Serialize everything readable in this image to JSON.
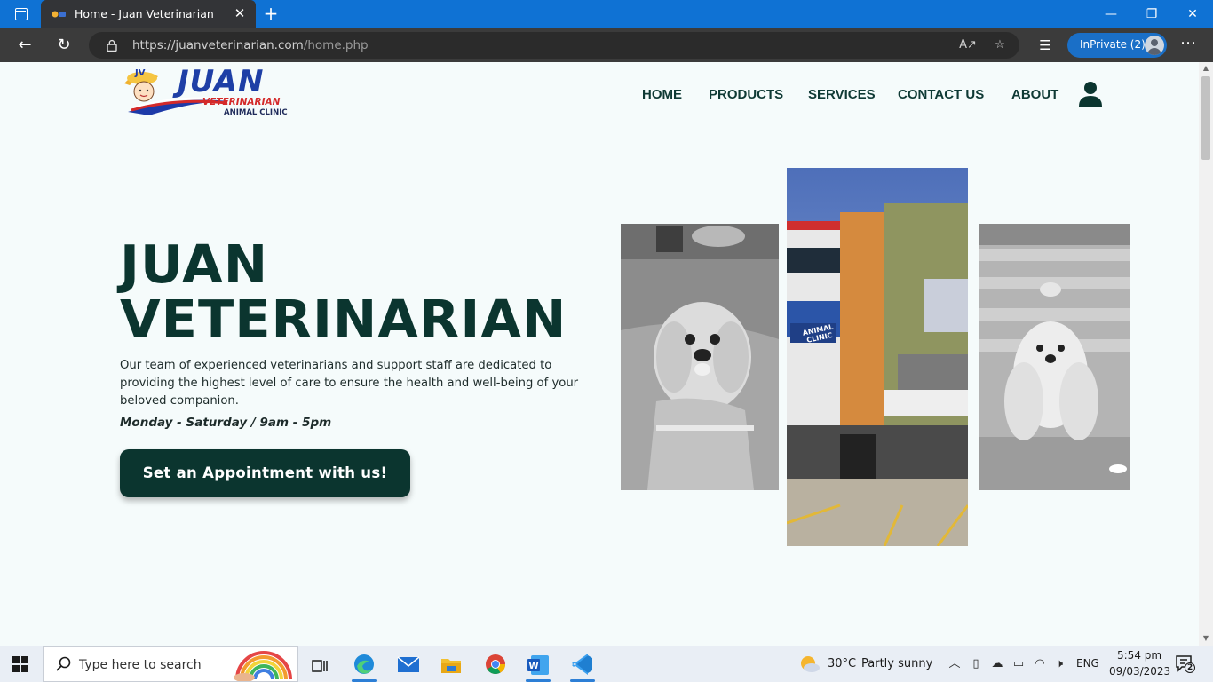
{
  "browser": {
    "tab_title": "Home - Juan Veterinarian",
    "url_host": "https://juanveterinarian.com",
    "url_path": "/home.php",
    "inprivate_label": "InPrivate (2)"
  },
  "site": {
    "logo_initials": "JV",
    "logo_main": "JUAN",
    "logo_sub": "VETERINARIAN",
    "logo_tag": "ANIMAL CLINIC",
    "nav": [
      "HOME",
      "PRODUCTS",
      "SERVICES",
      "CONTACT US",
      "ABOUT"
    ]
  },
  "hero": {
    "title_line1": "JUAN",
    "title_line2": "VETERINARIAN",
    "description": "Our team of experienced veterinarians and support staff are dedicated to providing the highest level of care to ensure the health and well-being of your beloved companion.",
    "hours": "Monday - Saturday / 9am - 5pm",
    "cta_label": "Set an Appointment with us!",
    "storefront_sign": "ANIMAL CLINIC"
  },
  "taskbar": {
    "search_placeholder": "Type here to search",
    "weather_temp": "30°C",
    "weather_desc": "Partly sunny",
    "lang": "ENG",
    "time": "5:54 pm",
    "date": "09/03/2023",
    "notifications": "2"
  },
  "colors": {
    "brand_dark": "#0b352f",
    "edge_blue": "#0f72d4",
    "page_bg": "#f5fbfb"
  }
}
